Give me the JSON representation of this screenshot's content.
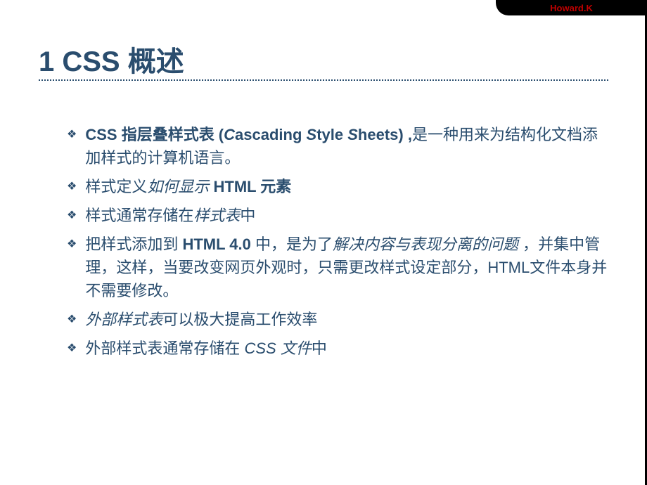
{
  "header": {
    "author": "Howard.K"
  },
  "title": "1 CSS 概述",
  "bullets": [
    {
      "parts": [
        {
          "text": "CSS 指层叠样式表 (",
          "style": "bold"
        },
        {
          "text": "C",
          "style": "bold-italic-en"
        },
        {
          "text": "ascading ",
          "style": "bold"
        },
        {
          "text": "S",
          "style": "bold-italic-en"
        },
        {
          "text": "tyle ",
          "style": "bold"
        },
        {
          "text": "S",
          "style": "bold-italic-en"
        },
        {
          "text": "heets) ,",
          "style": "bold"
        },
        {
          "text": "是一种用来为结构化文档添加样式的计算机语言。",
          "style": "normal"
        }
      ]
    },
    {
      "parts": [
        {
          "text": "样式定义",
          "style": "normal"
        },
        {
          "text": "如何显示",
          "style": "italic"
        },
        {
          "text": " HTML 元素",
          "style": "bold"
        }
      ]
    },
    {
      "parts": [
        {
          "text": "样式通常存储在",
          "style": "normal"
        },
        {
          "text": "样式表",
          "style": "italic"
        },
        {
          "text": "中",
          "style": "normal"
        }
      ]
    },
    {
      "parts": [
        {
          "text": "把样式添加到 ",
          "style": "normal"
        },
        {
          "text": "HTML 4.0 ",
          "style": "bold"
        },
        {
          "text": "中，是为了",
          "style": "normal"
        },
        {
          "text": "解决内容与表现分离的问题",
          "style": "italic"
        },
        {
          "text": " ，并集中管理，这样，当要改变网页外观时，只需更改样式设定部分，HTML文件本身并不需要修改。",
          "style": "normal"
        }
      ]
    },
    {
      "parts": [
        {
          "text": "外部样式表",
          "style": "italic"
        },
        {
          "text": "可以极大提高工作效率",
          "style": "normal"
        }
      ]
    },
    {
      "parts": [
        {
          "text": "外部样式表通常存储在 ",
          "style": "normal"
        },
        {
          "text": "CSS  文件",
          "style": "italic-en"
        },
        {
          "text": "中",
          "style": "normal"
        }
      ]
    }
  ]
}
